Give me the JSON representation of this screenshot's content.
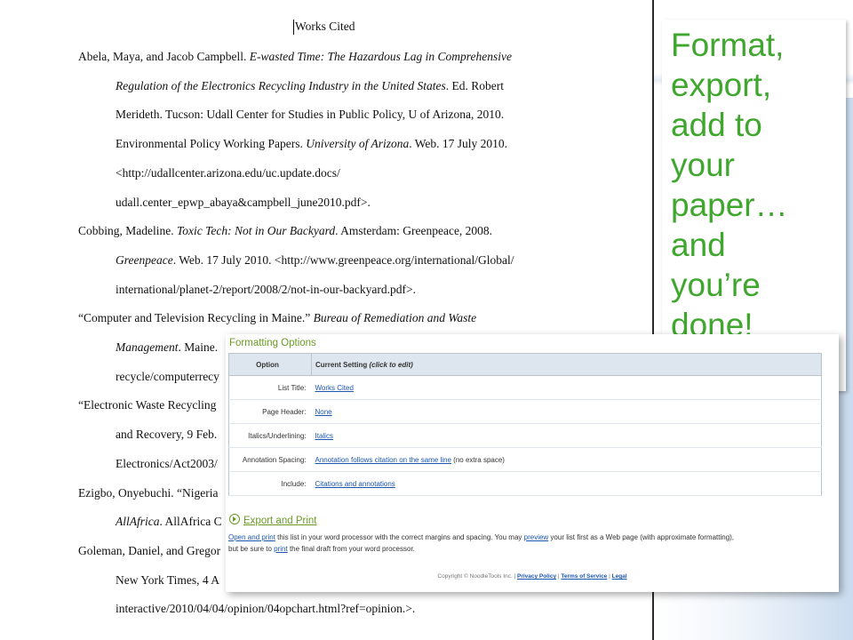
{
  "document": {
    "title": "Works Cited",
    "entries": [
      {
        "lines": [
          [
            {
              "t": "Abela, Maya, and Jacob Campbell. "
            },
            {
              "t": "E-wasted Time: The Hazardous Lag in Comprehensive",
              "i": true
            }
          ],
          [
            {
              "t": "Regulation of the Electronics Recycling Industry in the United States",
              "i": true
            },
            {
              "t": ". Ed. Robert"
            }
          ],
          [
            {
              "t": "Merideth. Tucson: Udall Center for Studies in Public Policy, U of Arizona, 2010."
            }
          ],
          [
            {
              "t": "Environmental Policy Working Papers. "
            },
            {
              "t": "University of Arizona",
              "i": true
            },
            {
              "t": ". Web. 17 July 2010."
            }
          ],
          [
            {
              "t": "<http://udallcenter.arizona.edu/uc.update.docs/"
            }
          ],
          [
            {
              "t": "udall.center_epwp_abaya&campbell_june2010.pdf>."
            }
          ]
        ]
      },
      {
        "lines": [
          [
            {
              "t": "Cobbing, Madeline. "
            },
            {
              "t": "Toxic Tech: Not in Our Backyard",
              "i": true
            },
            {
              "t": ". Amsterdam: Greenpeace, 2008."
            }
          ],
          [
            {
              "t": "Greenpeace",
              "i": true
            },
            {
              "t": ". Web. 17 July 2010. <http://www.greenpeace.org/international/Global/"
            }
          ],
          [
            {
              "t": "international/planet-2/report/2008/2/not-in-our-backyard.pdf>."
            }
          ]
        ]
      },
      {
        "lines": [
          [
            {
              "t": "“Computer and Television  Recycling in Maine.” "
            },
            {
              "t": "Bureau of Remediation and Waste",
              "i": true
            }
          ],
          [
            {
              "t": "Management",
              "i": true
            },
            {
              "t": ". Maine."
            }
          ],
          [
            {
              "t": "recycle/computerrecy"
            }
          ]
        ]
      },
      {
        "lines": [
          [
            {
              "t": "“Electronic Waste Recycling"
            }
          ],
          [
            {
              "t": "and Recovery, 9 Feb."
            }
          ],
          [
            {
              "t": "Electronics/Act2003/"
            }
          ]
        ]
      },
      {
        "lines": [
          [
            {
              "t": "Ezigbo, Onyebuchi.  “Nigeria"
            }
          ],
          [
            {
              "t": "AllAfrica",
              "i": true
            },
            {
              "t": ". AllAfrica C"
            }
          ]
        ]
      },
      {
        "lines": [
          [
            {
              "t": "Goleman, Daniel, and Gregor"
            }
          ],
          [
            {
              "t": "New York Times, 4 A"
            }
          ],
          [
            {
              "t": "interactive/2010/04/04/opinion/04opchart.html?ref=opinion.>."
            }
          ]
        ]
      }
    ]
  },
  "callout": {
    "lines": [
      "Format,",
      "export,",
      "add to",
      "your",
      "paper…",
      "and",
      "you’re",
      "done!"
    ],
    "color": "#3fa62e"
  },
  "panel": {
    "heading": "Formatting Options",
    "table_headers": {
      "option": "Option",
      "current": "Current Setting ",
      "current_hint": "(click to edit)"
    },
    "rows": [
      {
        "option": "List Title:",
        "value": "Works Cited",
        "extra": ""
      },
      {
        "option": "Page Header:",
        "value": "None",
        "extra": ""
      },
      {
        "option": "Italics/Underlining:",
        "value": "Italics",
        "extra": ""
      },
      {
        "option": "Annotation Spacing:",
        "value": "Annotation follows citation on the same line",
        "extra": " (no extra space)"
      },
      {
        "option": "Include:",
        "value": "Citations and annotations",
        "extra": ""
      }
    ],
    "export_title": "Export and Print",
    "export_text": {
      "link1": "Open and print",
      "t1": " this list in your word processor with the correct margins and spacing. You may ",
      "link2": "preview",
      "t2": " your list first as a Web page (with approximate formatting),",
      "t3": "but be sure to ",
      "link3": "print",
      "t4": " the final draft from your word processor."
    },
    "footer": {
      "copyright": "Copyright © NoodleTools Inc. | ",
      "privacy": "Privacy Policy",
      "sep1": " | ",
      "terms": "Terms of Service",
      "sep2": " | ",
      "legal": "Legal"
    }
  }
}
